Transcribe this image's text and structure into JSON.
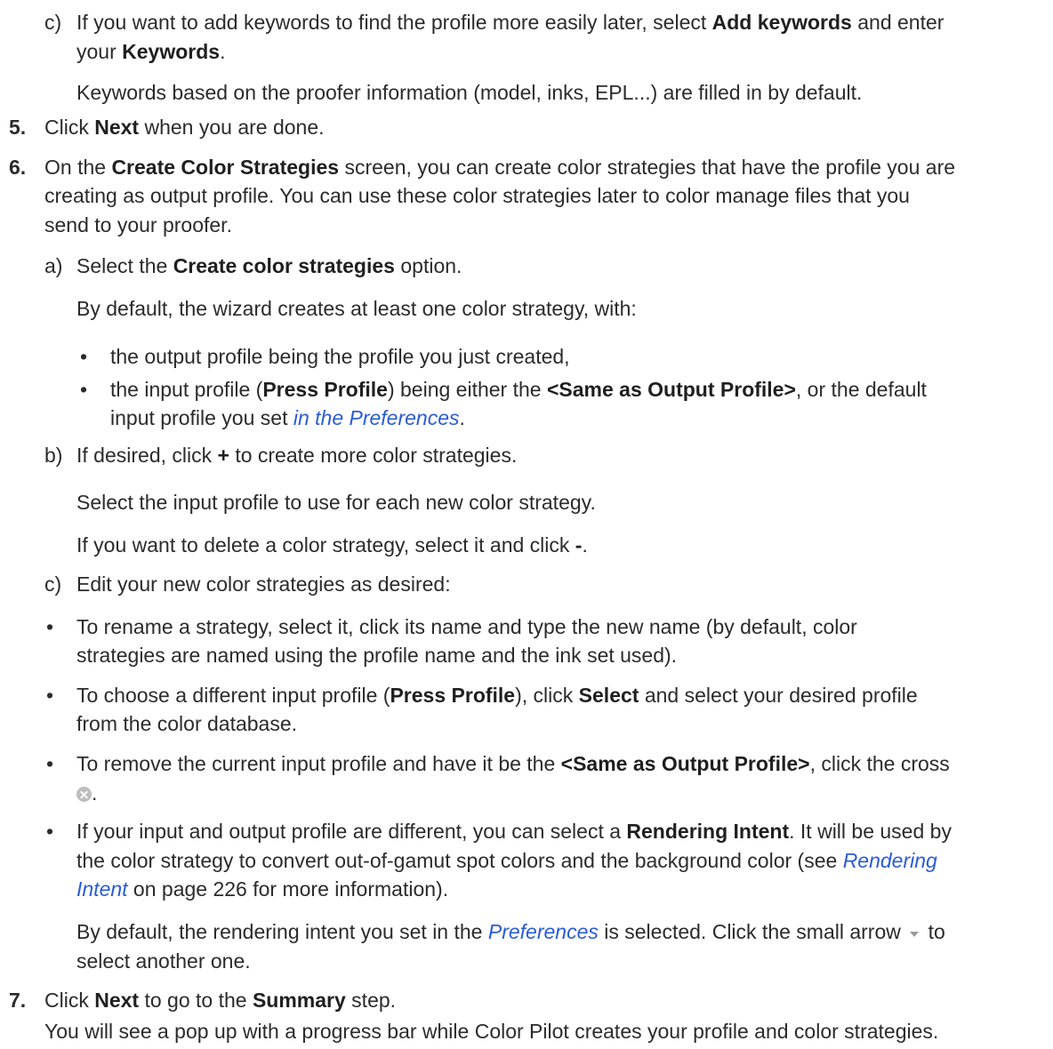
{
  "c1": {
    "marker": "c)",
    "l1_pre": "If you want to add keywords to find the profile more easily later, select ",
    "l1_b1": "Add keywords",
    "l1_post": " and enter",
    "l2_pre": "your ",
    "l2_b": "Keywords",
    "l2_post": ".",
    "note": "Keywords based on the proofer information (model, inks, EPL...) are filled in by default."
  },
  "step5": {
    "num": "5.",
    "pre": "Click ",
    "b": "Next",
    "post": " when you are done."
  },
  "step6": {
    "num": "6.",
    "l1_pre": "On the ",
    "l1_b": "Create Color Strategies",
    "l1_post": " screen, you can create color strategies that have the profile you are",
    "l2": "creating as output profile. You can use these color strategies later to color manage files that you",
    "l3": "send to your proofer."
  },
  "a": {
    "marker": "a)",
    "pre": "Select the ",
    "b": "Create color strategies",
    "post": " option.",
    "note": "By default, the wizard creates at least one color strategy, with:",
    "bullet1": "the output profile being the profile you just created,",
    "bullet2_pre": "the input profile (",
    "bullet2_b1": "Press Profile",
    "bullet2_mid": ") being either the ",
    "bullet2_b2": "<Same as Output Profile>",
    "bullet2_post": ", or the default",
    "bullet2_l2_pre": "input profile you set ",
    "bullet2_l2_link": "in the Preferences",
    "bullet2_l2_post": "."
  },
  "b": {
    "marker": "b)",
    "pre": "If desired, click ",
    "plus": "+",
    "post": " to create more color strategies.",
    "note1": "Select the input profile to use for each new color strategy.",
    "note2_pre": "If you want to delete a color strategy, select it and click ",
    "note2_minus": "-",
    "note2_post": "."
  },
  "c2": {
    "marker": "c)",
    "text": "Edit your new color strategies as desired:"
  },
  "list": {
    "i1_l1": "To rename a strategy, select it, click its name and type the new name (by default, color",
    "i1_l2": "strategies are named using the profile name and the ink set used).",
    "i2_l1_pre": "To choose a different input profile (",
    "i2_l1_b1": "Press Profile",
    "i2_l1_mid": "), click ",
    "i2_l1_b2": "Select",
    "i2_l1_post": " and select your desired profile",
    "i2_l2": "from the color database.",
    "i3_l1_pre": "To remove the current input profile and have it be the ",
    "i3_l1_b": "<Same as Output Profile>",
    "i3_l1_post": ", click the cross",
    "i3_l2_icon": "cross-circle-icon",
    "i3_l2_post": ".",
    "i4_l1_pre": "If your input and output profile are different, you can select a ",
    "i4_l1_b": "Rendering Intent",
    "i4_l1_post": ". It will be used by",
    "i4_l2_pre": "the color strategy to convert out-of-gamut spot colors and the background color (see ",
    "i4_l2_link": "Rendering",
    "i4_l3_link": "Intent",
    "i4_l3_post": " on page 226 for more information).",
    "note_pre": "By default, the rendering intent you set in the ",
    "note_link": "Preferences",
    "note_mid": " is selected. Click the small arrow ",
    "note_icon": "small-arrow-down-icon",
    "note_post": " to",
    "note_l2": "select another one."
  },
  "step7": {
    "num": "7.",
    "pre": "Click ",
    "b1": "Next",
    "mid": " to go to the ",
    "b2": "Summary",
    "post": " step.",
    "note": "You will see a pop up with a progress bar while Color Pilot creates your profile and color strategies."
  }
}
